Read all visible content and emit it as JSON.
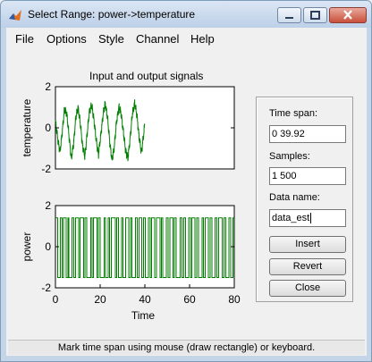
{
  "window": {
    "title": "Select Range: power->temperature",
    "icon": "matlab-icon",
    "controls": [
      "minimize-icon",
      "maximize-icon",
      "close-icon"
    ]
  },
  "menu": [
    "File",
    "Options",
    "Style",
    "Channel",
    "Help"
  ],
  "plot_title": "Input and output signals",
  "panel": {
    "time_span_label": "Time span:",
    "time_span_value": "0 39.92",
    "samples_label": "Samples:",
    "samples_value": "1 500",
    "data_name_label": "Data name:",
    "data_name_value": "data_est",
    "insert_label": "Insert",
    "revert_label": "Revert",
    "close_label": "Close"
  },
  "status_text": "Mark time span using mouse (draw rectangle) or keyboard.",
  "colors": {
    "signal": "#007f00",
    "frame": "#c5d5e8"
  },
  "chart_data": [
    {
      "type": "line",
      "title": "Input and output signals",
      "ylabel": "temperature",
      "xlabel": "",
      "xlim": [
        0,
        80
      ],
      "ylim": [
        -2,
        2
      ],
      "yticks": [
        "2",
        "0",
        "-2"
      ],
      "grid": false,
      "samples": 500,
      "ts": 0.08,
      "y": [
        0.3,
        -0.5,
        -1.2,
        -0.2,
        0.9,
        0.7,
        -0.4,
        -1.5,
        -0.8,
        0.5,
        1.0,
        0.2,
        -0.9,
        -1.4,
        -0.3,
        0.8,
        1.1,
        0.4,
        -0.6,
        -1.3,
        -0.4,
        0.6,
        1.2,
        0.5,
        -0.7,
        -1.6,
        -0.9,
        0.3,
        1.0,
        0.7,
        -0.2,
        -1.1,
        -1.5,
        -0.5,
        0.7,
        1.2,
        0.6,
        -0.5,
        -1.2,
        -0.3,
        0.8,
        1.0,
        0.1,
        -1.0,
        -1.5,
        -0.6,
        0.5,
        1.1,
        0.9,
        -0.3,
        -1.2,
        -0.7,
        0.4,
        1.2,
        0.8,
        -0.4,
        -1.4,
        -1.0,
        0.2,
        1.0,
        1.1,
        0.1,
        -0.9,
        -1.6,
        -0.7,
        0.6,
        1.2,
        0.6,
        -0.5,
        -1.3,
        -0.6,
        0.5,
        1.1,
        0.7,
        -0.3,
        -1.2,
        -1.4,
        -0.2,
        0.9,
        1.1
      ]
    },
    {
      "type": "line",
      "title": "",
      "ylabel": "power",
      "xlabel": "Time",
      "xlim": [
        0,
        80
      ],
      "ylim": [
        -2,
        2
      ],
      "xticks": [
        "0",
        "20",
        "40",
        "60",
        "80"
      ],
      "yticks": [
        "2",
        "0",
        "-2"
      ],
      "grid": false,
      "levels": [
        -1.5,
        1.4
      ],
      "switch_times": [
        1.0,
        2.2,
        3.0,
        3.6,
        4.8,
        5.6,
        6.0,
        7.4,
        8.2,
        9.0,
        10.4,
        11.0,
        12.6,
        13.2,
        14.0,
        15.8,
        16.4,
        17.0,
        18.6,
        19.2,
        20.0,
        21.8,
        22.4,
        23.6,
        24.2,
        25.0,
        26.8,
        27.4,
        28.2,
        29.6,
        30.2,
        31.4,
        32.8,
        33.6,
        34.2,
        35.8,
        36.6,
        37.4,
        38.6,
        39.4,
        40.2,
        41.6,
        42.4,
        43.0,
        44.4,
        45.2,
        46.8,
        47.4,
        48.0,
        49.6,
        50.4,
        51.2,
        52.6,
        53.2,
        54.0,
        55.8,
        56.6,
        57.4,
        58.2,
        59.6,
        60.4,
        61.0,
        62.4,
        63.2,
        64.0,
        65.6,
        66.2,
        67.0,
        68.4,
        69.2,
        70.0,
        71.4,
        72.2,
        73.0,
        74.6,
        75.4,
        76.2,
        77.6,
        78.4,
        79.4
      ]
    }
  ]
}
